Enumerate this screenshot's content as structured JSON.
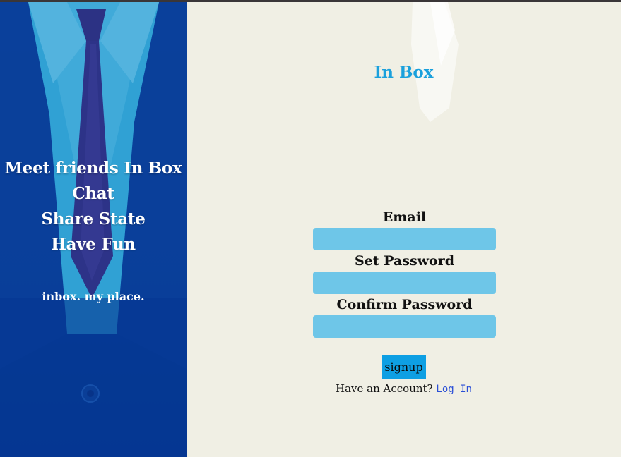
{
  "brand": {
    "title": "In Box"
  },
  "hero": {
    "lines": [
      "Meet friends In Box",
      "Chat",
      "Share State",
      "Have Fun"
    ],
    "tagline": "inbox. my place."
  },
  "form": {
    "email_label": "Email",
    "email_value": "",
    "set_password_label": "Set Password",
    "set_password_value": "",
    "confirm_password_label": "Confirm Password",
    "confirm_password_value": "",
    "submit_label": "signup"
  },
  "footer": {
    "prompt": "Have an Account?",
    "login_link": "Log In"
  },
  "colors": {
    "accent": "#1aa0dc",
    "input_bg": "#6ec6e8",
    "button_bg": "#0e9fe3",
    "link": "#2b4fd6",
    "panel_bg": "#f0efe4",
    "hero_bg": "#073f9a"
  }
}
